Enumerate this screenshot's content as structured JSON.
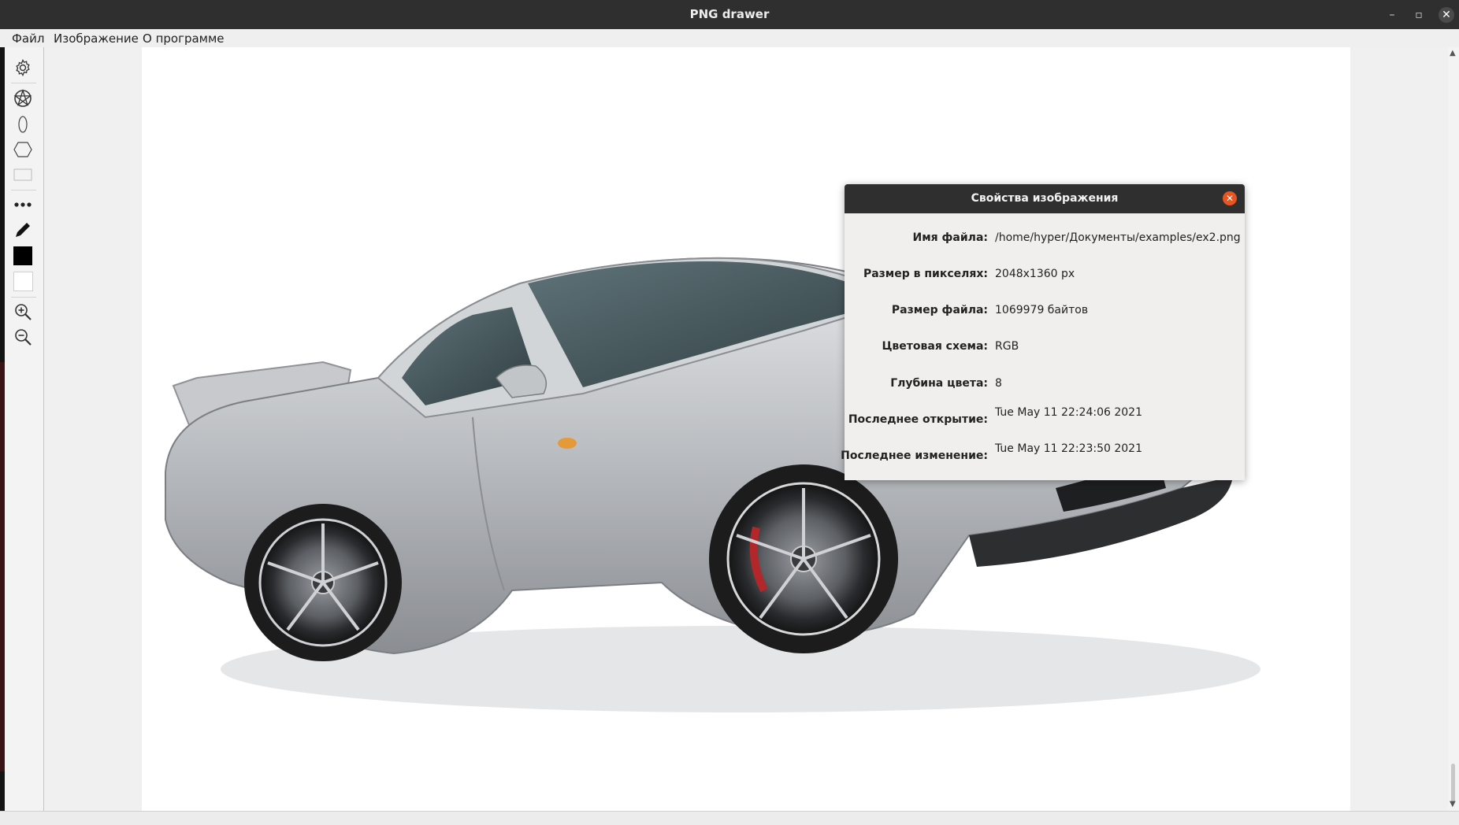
{
  "window": {
    "title": "PNG drawer"
  },
  "menu": {
    "items": [
      "Файл",
      "Изображение",
      "О программе"
    ]
  },
  "toolbar": {
    "tools": [
      "gear-icon",
      "polygon-star-icon",
      "ellipse-icon",
      "hexagon-icon",
      "rectangle-icon",
      "dots-icon",
      "pen-icon",
      "primary-color-swatch",
      "secondary-color-swatch",
      "zoom-in-icon",
      "zoom-out-icon"
    ],
    "primary_color": "#000000",
    "secondary_color": "#ffffff"
  },
  "dialog": {
    "title": "Свойства изображения",
    "rows": [
      {
        "label": "Имя файла:",
        "value": "/home/hyper/Документы/examples/ex2.png"
      },
      {
        "label": "Размер в пикселях:",
        "value": "2048x1360 px"
      },
      {
        "label": "Размер файла:",
        "value": "1069979 байтов"
      },
      {
        "label": "Цветовая схема:",
        "value": "RGB"
      },
      {
        "label": "Глубина цвета:",
        "value": "8"
      },
      {
        "label": "Последнее открытие:",
        "value": "Tue May 11 22:24:06 2021"
      },
      {
        "label": "Последнее изменение:",
        "value": "Tue May 11 22:23:50 2021"
      }
    ]
  },
  "colors": {
    "accent": "#e95420",
    "titlebar": "#2f2f2f"
  }
}
